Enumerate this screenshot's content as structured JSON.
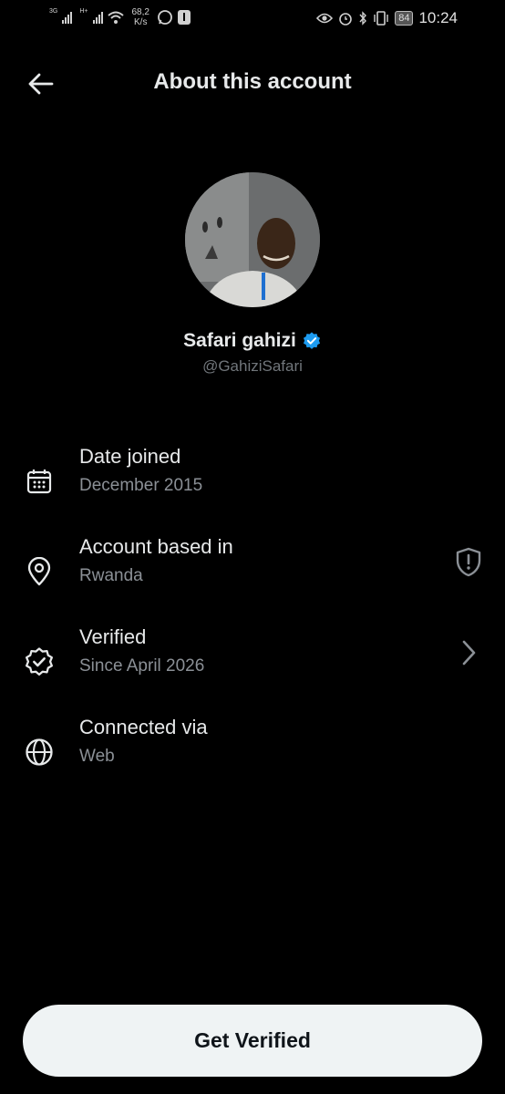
{
  "status_bar": {
    "net1": "3G",
    "net2": "H+",
    "speed_value": "68,2",
    "speed_unit": "K/s",
    "battery": "84",
    "time": "10:24"
  },
  "header": {
    "title": "About this account"
  },
  "profile": {
    "name": "Safari gahizi",
    "handle": "@GahiziSafari"
  },
  "rows": [
    {
      "icon": "calendar-icon",
      "label": "Date joined",
      "value": "December 2015"
    },
    {
      "icon": "location-pin-icon",
      "label": "Account based in",
      "value": "Rwanda",
      "trailing_icon": "shield-alert-icon"
    },
    {
      "icon": "verified-badge-icon",
      "label": "Verified",
      "value": "Since April 2026",
      "trailing_icon": "chevron-right-icon"
    },
    {
      "icon": "globe-icon",
      "label": "Connected via",
      "value": "Web"
    }
  ],
  "cta": {
    "label": "Get Verified"
  },
  "colors": {
    "background": "#000000",
    "primary_text": "#e7e9ea",
    "secondary_text": "#71767b",
    "verified_blue": "#1d9bf0",
    "button_bg": "#eff3f4"
  }
}
